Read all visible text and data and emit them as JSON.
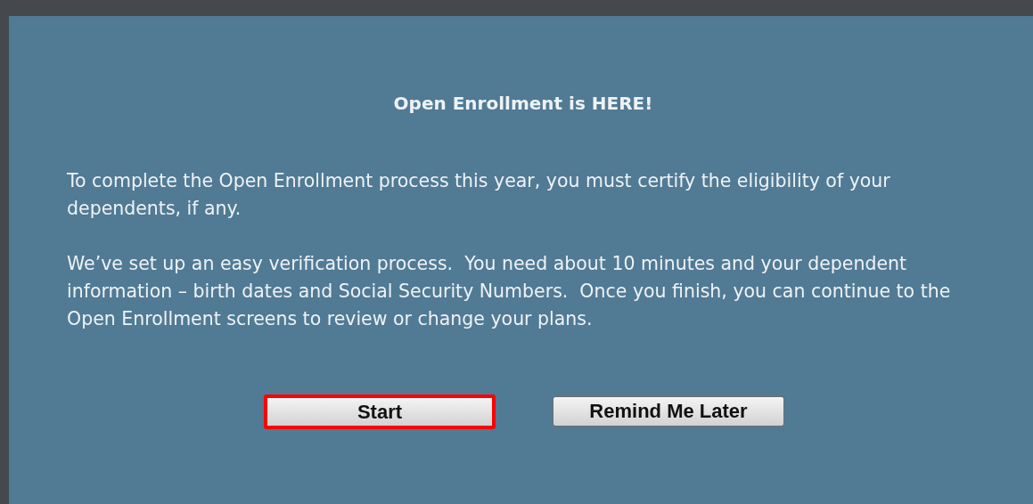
{
  "dialog": {
    "title": "Open Enrollment is HERE!",
    "paragraphs": [
      "To complete the Open Enrollment process this year, you must certify the eligibility of your dependents, if any.",
      "We’ve set up an easy verification process.  You need about 10 minutes and your dependent information – birth dates and Social Security Numbers.  Once you finish, you can continue to the Open Enrollment screens to review or change your plans."
    ],
    "buttons": [
      {
        "label": "Start",
        "highlighted": true
      },
      {
        "label": "Remind Me Later",
        "highlighted": false
      }
    ]
  }
}
